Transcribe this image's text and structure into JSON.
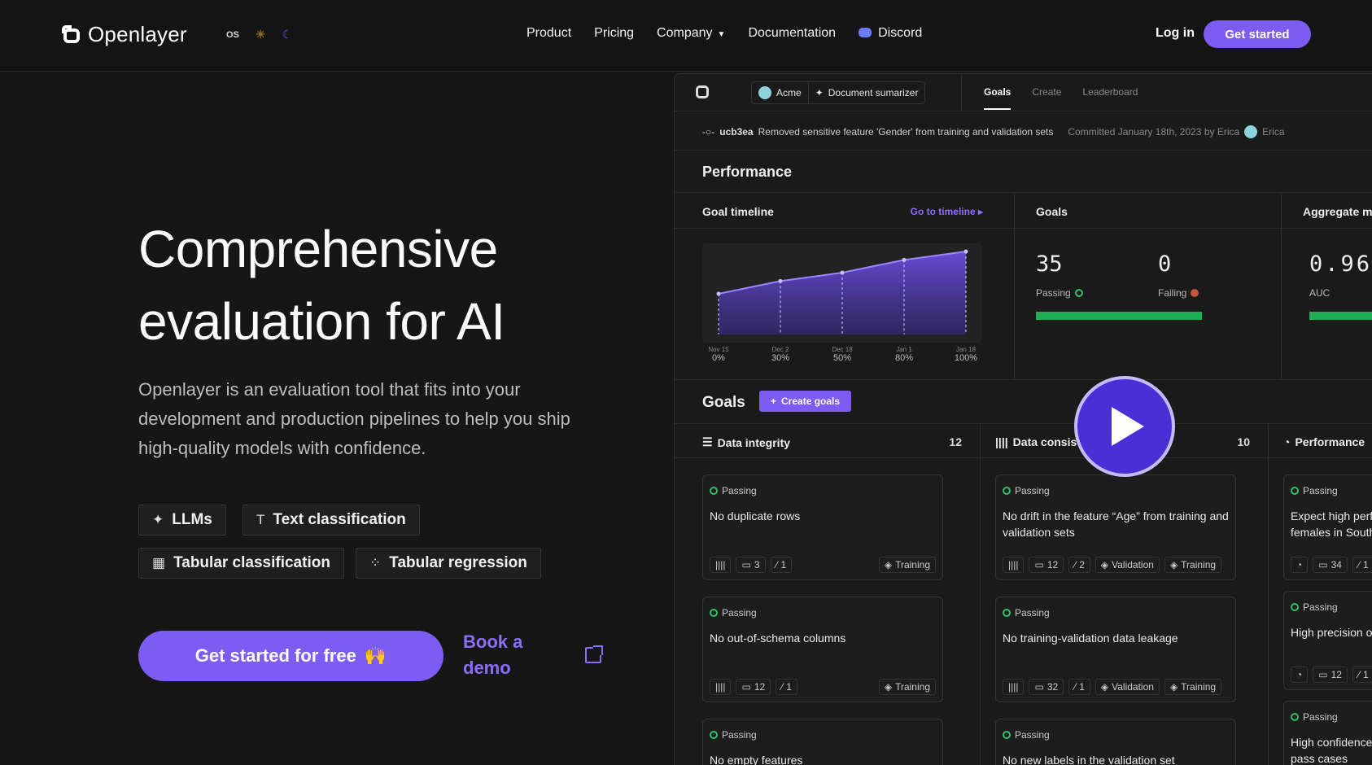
{
  "nav": {
    "brand": "Openlayer",
    "theme_os": "OS",
    "links": [
      "Product",
      "Pricing",
      "Company",
      "Documentation",
      "Discord"
    ],
    "login": "Log in",
    "get_started": "Get started"
  },
  "hero": {
    "title_line1": "Comprehensive",
    "title_line2": "evaluation for AI",
    "description": "Openlayer is an evaluation tool that fits into your development and production pipelines to help you ship high-quality models with confidence.",
    "tags": [
      "LLMs",
      "Text classification",
      "Tabular classification",
      "Tabular regression"
    ],
    "cta": "Get started for free",
    "cta_emoji": "🙌",
    "demo": "Book a demo"
  },
  "dashboard": {
    "crumbs": [
      "Acme",
      "Document sumarizer"
    ],
    "tabs": [
      "Goals",
      "Create",
      "Leaderboard"
    ],
    "commit": {
      "hash": "ucb3ea",
      "message": "Removed sensitive feature 'Gender' from training and validation sets",
      "meta": "Committed January 18th, 2023 by Erica",
      "user": "Erica"
    },
    "performance_title": "Performance",
    "timeline": {
      "title": "Goal timeline",
      "link": "Go to timeline",
      "dates": [
        "Nov 15",
        "Dec 2",
        "Dec 18",
        "Jan 1",
        "Jan 18"
      ],
      "values": [
        "0%",
        "30%",
        "50%",
        "80%",
        "100%"
      ]
    },
    "goals_panel": {
      "title": "Goals",
      "passing_count": "35",
      "passing_label": "Passing",
      "failing_count": "0",
      "failing_label": "Failing",
      "passing_fraction": 1.0
    },
    "aggregate": {
      "title": "Aggregate me",
      "value": "0.96",
      "label": "AUC"
    },
    "goals_section": {
      "title": "Goals",
      "create": "Create goals"
    },
    "columns": [
      {
        "title": "Data integrity",
        "count": "12",
        "cards": [
          {
            "status": "Passing",
            "title": "No duplicate rows",
            "comments": "3",
            "tests": "1",
            "tags": [
              "Training"
            ]
          },
          {
            "status": "Passing",
            "title": "No out-of-schema columns",
            "comments": "12",
            "tests": "1",
            "tags": [
              "Training"
            ]
          },
          {
            "status": "Passing",
            "title": "No empty features"
          }
        ]
      },
      {
        "title": "Data consis",
        "count": "10",
        "cards": [
          {
            "status": "Passing",
            "title": "No drift in the feature “Age” from training and validation sets",
            "comments": "12",
            "tests": "2",
            "tags": [
              "Validation",
              "Training"
            ]
          },
          {
            "status": "Passing",
            "title": "No training-validation data leakage",
            "comments": "32",
            "tests": "1",
            "tags": [
              "Validation",
              "Training"
            ]
          },
          {
            "status": "Passing",
            "title": "No new labels in the validation set"
          }
        ]
      },
      {
        "title": "Performance",
        "count": "",
        "cards": [
          {
            "status": "Passing",
            "title": "Expect high perfor females in South A",
            "comments": "34",
            "tests": "1"
          },
          {
            "status": "Passing",
            "title": "High precision on",
            "comments": "12",
            "tests": "1"
          },
          {
            "status": "Passing",
            "title": "High confidence a pass cases"
          }
        ]
      }
    ]
  },
  "chart_data": {
    "type": "area",
    "categories": [
      "Nov 15",
      "Dec 2",
      "Dec 18",
      "Jan 1",
      "Jan 18"
    ],
    "values": [
      0,
      30,
      50,
      80,
      100
    ],
    "ylim": [
      0,
      100
    ]
  },
  "colors": {
    "accent": "#7c5cf2",
    "pass": "#2fbf6a",
    "fail": "#c8553d",
    "bg": "#161616"
  }
}
